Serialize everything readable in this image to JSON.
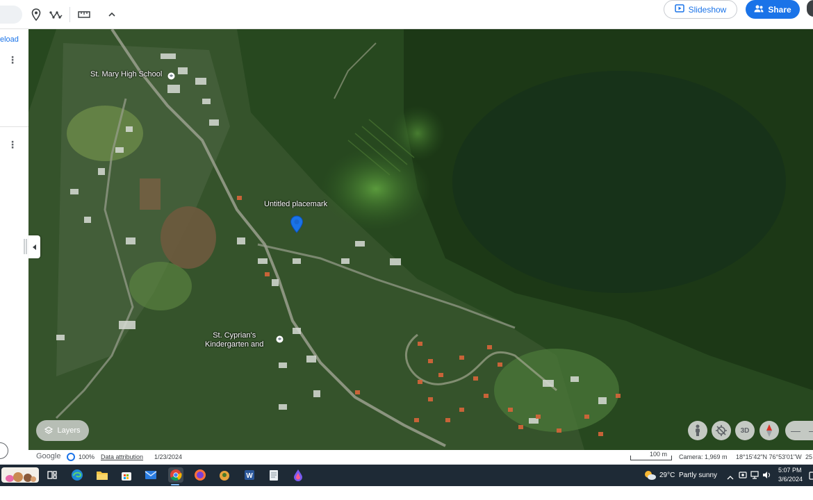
{
  "toolbar": {
    "icons": [
      "placemark-icon",
      "path-icon",
      "ruler-icon",
      "chevron-up-icon"
    ],
    "slideshow_label": "Slideshow",
    "share_label": "Share"
  },
  "left_panel": {
    "reload_link": "eload",
    "kebab_glyph": "⋮"
  },
  "map": {
    "labels": {
      "school": "St. Mary High School",
      "placemark": "Untitled placemark",
      "kindergarten_line1": "St. Cyprian's",
      "kindergarten_line2": "Kindergarten and"
    },
    "layers_label": "Layers",
    "ctrl_3d_label": "3D",
    "colors": {
      "pin": "#1a73e8",
      "forest": "#1f3f19",
      "clearing": "#4f8a36",
      "roof": "#d8653a"
    }
  },
  "status_bar": {
    "brand": "Google",
    "opacity": "100%",
    "attribution": "Data attribution",
    "imagery_date": "1/23/2024",
    "scale": "100 m",
    "camera": "Camera: 1,969 m",
    "coordinates": "18°15'42\"N 76°53'01\"W",
    "elevation_partial": "25"
  },
  "taskbar": {
    "apps": [
      "widgets-icon",
      "task-view-icon",
      "edge-icon",
      "file-explorer-icon",
      "store-icon",
      "mail-icon",
      "chrome-icon",
      "firefox-icon",
      "vpn-icon",
      "word-icon",
      "notes-icon",
      "paint-icon"
    ],
    "weather_temp": "29°C",
    "weather_text": "Partly sunny",
    "time": "5:07 PM",
    "date": "3/6/2024"
  }
}
